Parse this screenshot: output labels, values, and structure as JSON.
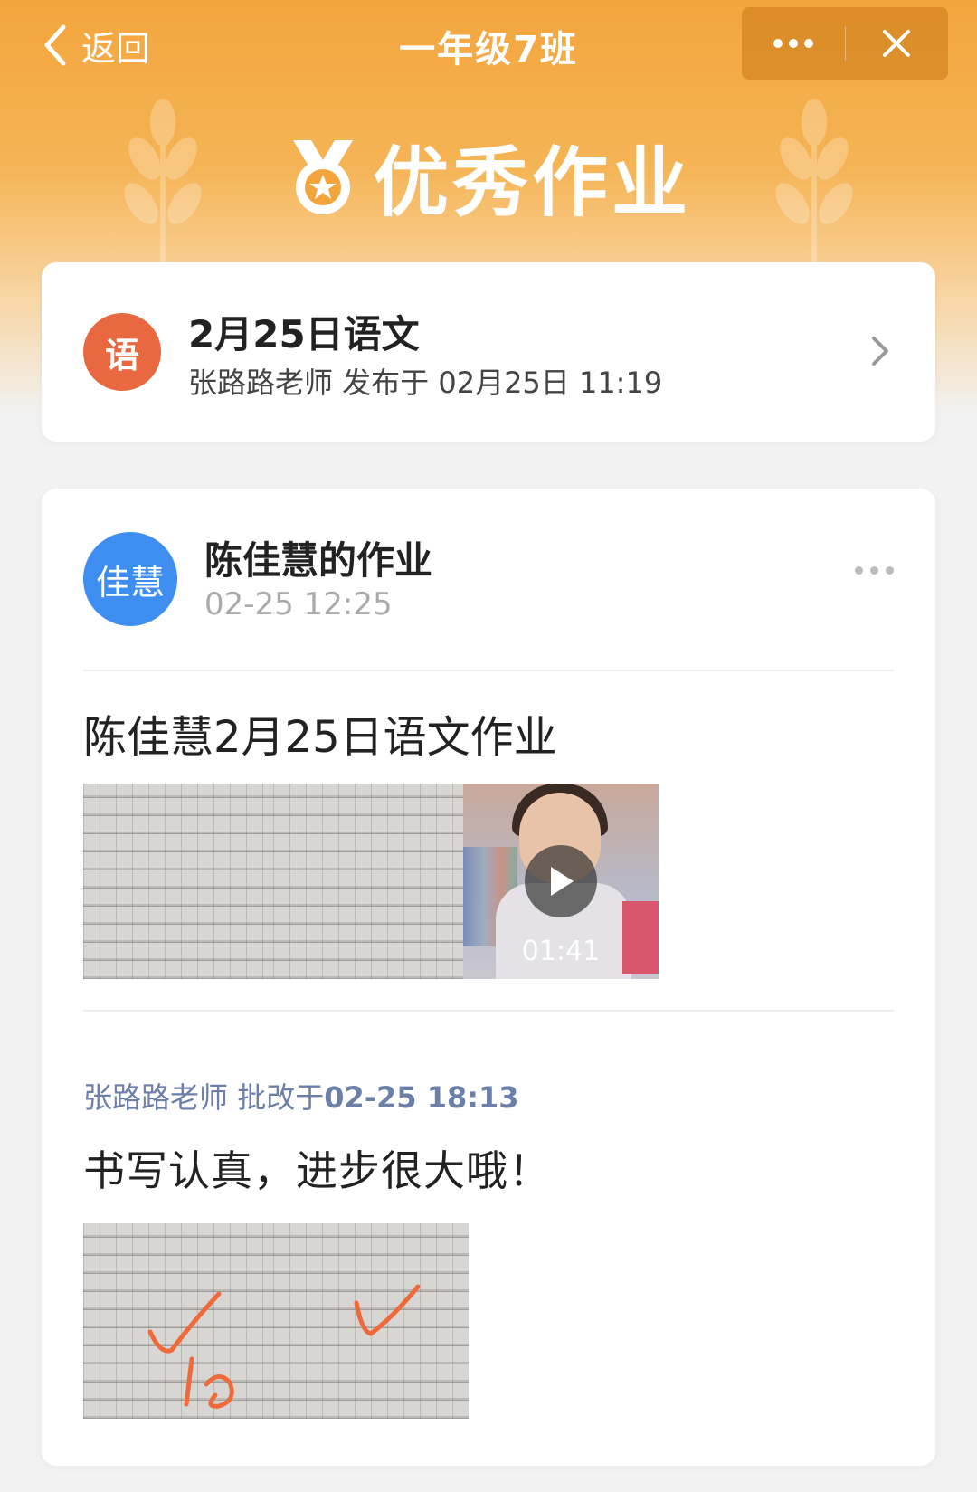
{
  "nav": {
    "back_label": "返回",
    "title": "一年级7班"
  },
  "banner": {
    "title": "优秀作业"
  },
  "assignment": {
    "subject_badge": "语",
    "title": "2月25日语文",
    "subtitle": "张路路老师 发布于 02月25日 11:19"
  },
  "submission": {
    "avatar_text": "佳慧",
    "student_title": "陈佳慧的作业",
    "time": "02-25 12:25",
    "homework_title": "陈佳慧2月25日语文作业",
    "video_duration": "01:41",
    "review": {
      "teacher": "张路路老师",
      "action": " 批改于",
      "time": "02-25 18:13",
      "comment": "书写认真，进步很大哦！"
    }
  },
  "colors": {
    "header_orange": "#f3a53d",
    "subject_badge": "#e8683f",
    "avatar_blue": "#3d8ef0",
    "reviewer_text": "#6b7fa8",
    "check_mark": "#ef6a3a"
  }
}
